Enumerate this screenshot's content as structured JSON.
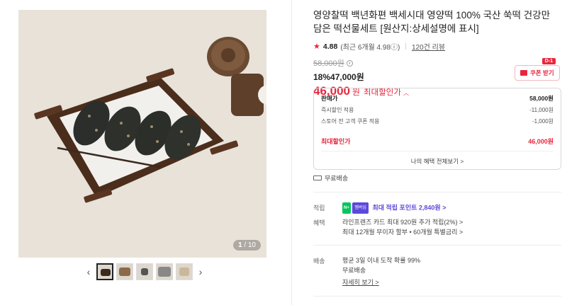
{
  "gallery": {
    "counter_current": "1",
    "counter_total": "/ 10",
    "prev_icon": "chevron-left",
    "next_icon": "chevron-right",
    "thumbnail_count": 5
  },
  "product": {
    "title": "영양찰떡 백년화편 백세시대 영양떡 100% 국산 쑥떡 건강만 담은 떡선물세트 [원산지:상세설명에 표시]",
    "rating": "4.88",
    "rating_recent": "(최근 6개월 4.98ⓘ)",
    "review_link": "120건 리뷰",
    "original_price": "58,000원",
    "discount_line": "18%47,000원",
    "final_price": "46,000",
    "final_won": "원",
    "final_label": "최대할인가",
    "final_caret": "^"
  },
  "coupon": {
    "badge": "D-1",
    "label": "쿠폰 받기"
  },
  "price_box": {
    "rows": [
      {
        "label": "판매가",
        "value": "58,000원"
      },
      {
        "label": "즉시할인 적용",
        "value": "-11,000원"
      },
      {
        "label": "스토어 전 고객 쿠폰 적용",
        "value": "-1,000원"
      }
    ],
    "max_label": "최대할인가",
    "max_value": "46,000원",
    "more_link": "나의 혜택 전체보기 >"
  },
  "shipping_free": "무료배송",
  "points": {
    "label": "적립",
    "npay": "N+",
    "membership": "멤버십",
    "text": "최대 적립 포인트 2,840원 >"
  },
  "benefits": {
    "label": "혜택",
    "line1": "라인프렌즈 카드 최대 920원 추가 적립(2%) >",
    "line2": "최대 12개월 무이자 할부 • 60개월 특별금리 >"
  },
  "delivery": {
    "label": "배송",
    "line1": "평균 3일 이내 도착 확률 99%",
    "line2": "무료배송",
    "more": "자세히 보기 >"
  },
  "colors": {
    "accent_red": "#e9263d",
    "point_purple": "#5b49d9",
    "npay_green": "#03c75a"
  }
}
